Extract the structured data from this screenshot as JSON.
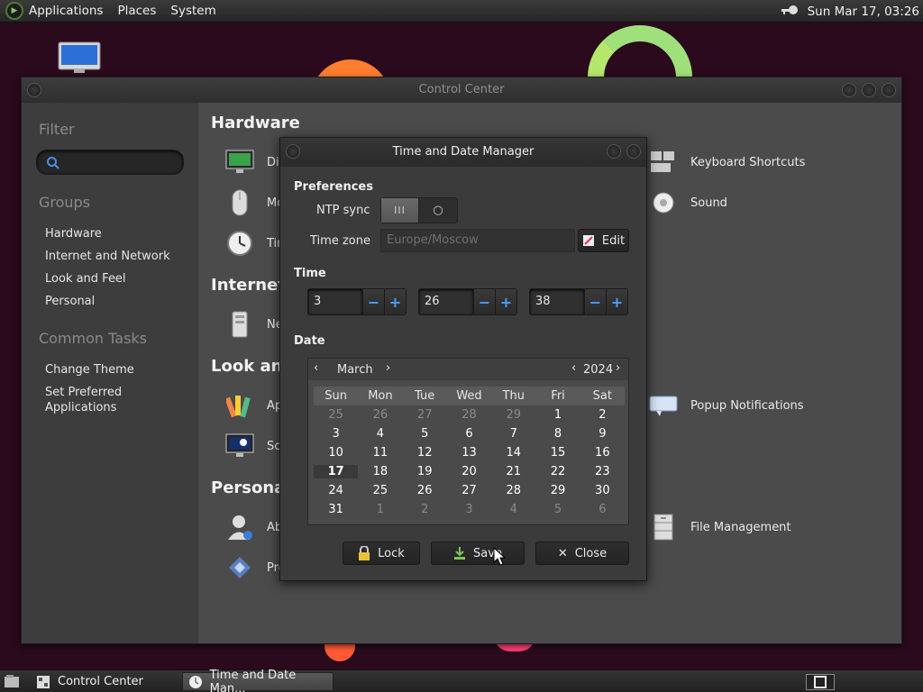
{
  "top_panel": {
    "menus": [
      "Applications",
      "Places",
      "System"
    ],
    "clock": "Sun Mar 17, 03:26"
  },
  "control_center": {
    "title": "Control Center",
    "sidebar": {
      "filter_heading": "Filter",
      "groups_heading": "Groups",
      "groups": [
        "Hardware",
        "Internet and Network",
        "Look and Feel",
        "Personal"
      ],
      "common_heading": "Common Tasks",
      "tasks": [
        "Change Theme",
        "Set Preferred",
        "Applications"
      ]
    },
    "sections": {
      "hardware": "Hardware",
      "internet": "Internet a",
      "look": "Look and",
      "personal": "Personal"
    },
    "items": {
      "display": "Dis",
      "mouse": "Mo",
      "time": "Tim",
      "network": "Ne",
      "appearance": "Ap",
      "screensaver": "Scr",
      "about": "Ab",
      "preferred": "Pre",
      "keyboard": "Keyboard Shortcuts",
      "sound": "Sound",
      "popup": "Popup Notifications",
      "file": "File Management"
    }
  },
  "dialog": {
    "title": "Time and Date Manager",
    "preferences_label": "Preferences",
    "ntp_label": "NTP sync",
    "timezone_label": "Time zone",
    "timezone_value": "Europe/Moscow",
    "edit_label": "Edit",
    "time_label": "Time",
    "hours": "3",
    "minutes": "26",
    "seconds": "38",
    "date_label": "Date",
    "calendar": {
      "month": "March",
      "year": "2024",
      "weekdays": [
        "Sun",
        "Mon",
        "Tue",
        "Wed",
        "Thu",
        "Fri",
        "Sat"
      ],
      "rows": [
        [
          [
            "25",
            "dim"
          ],
          [
            "26",
            "dim"
          ],
          [
            "27",
            "dim"
          ],
          [
            "28",
            "dim"
          ],
          [
            "29",
            "dim"
          ],
          [
            "1",
            "cur"
          ],
          [
            "2",
            "cur"
          ]
        ],
        [
          [
            "3",
            "cur"
          ],
          [
            "4",
            "cur"
          ],
          [
            "5",
            "cur"
          ],
          [
            "6",
            "cur"
          ],
          [
            "7",
            "cur"
          ],
          [
            "8",
            "cur"
          ],
          [
            "9",
            "cur"
          ]
        ],
        [
          [
            "10",
            "cur"
          ],
          [
            "11",
            "cur"
          ],
          [
            "12",
            "cur"
          ],
          [
            "13",
            "cur"
          ],
          [
            "14",
            "cur"
          ],
          [
            "15",
            "cur"
          ],
          [
            "16",
            "cur"
          ]
        ],
        [
          [
            "17",
            "sel"
          ],
          [
            "18",
            "cur"
          ],
          [
            "19",
            "cur"
          ],
          [
            "20",
            "cur"
          ],
          [
            "21",
            "cur"
          ],
          [
            "22",
            "cur"
          ],
          [
            "23",
            "cur"
          ]
        ],
        [
          [
            "24",
            "cur"
          ],
          [
            "25",
            "cur"
          ],
          [
            "26",
            "cur"
          ],
          [
            "27",
            "cur"
          ],
          [
            "28",
            "cur"
          ],
          [
            "29",
            "cur"
          ],
          [
            "30",
            "cur"
          ]
        ],
        [
          [
            "31",
            "cur"
          ],
          [
            "1",
            "dim"
          ],
          [
            "2",
            "dim"
          ],
          [
            "3",
            "dim"
          ],
          [
            "4",
            "dim"
          ],
          [
            "5",
            "dim"
          ],
          [
            "6",
            "dim"
          ]
        ]
      ]
    },
    "buttons": {
      "lock": "Lock",
      "save": "Save",
      "close": "Close"
    }
  },
  "taskbar": {
    "tasks": [
      "Control Center",
      "Time and Date Man..."
    ]
  }
}
